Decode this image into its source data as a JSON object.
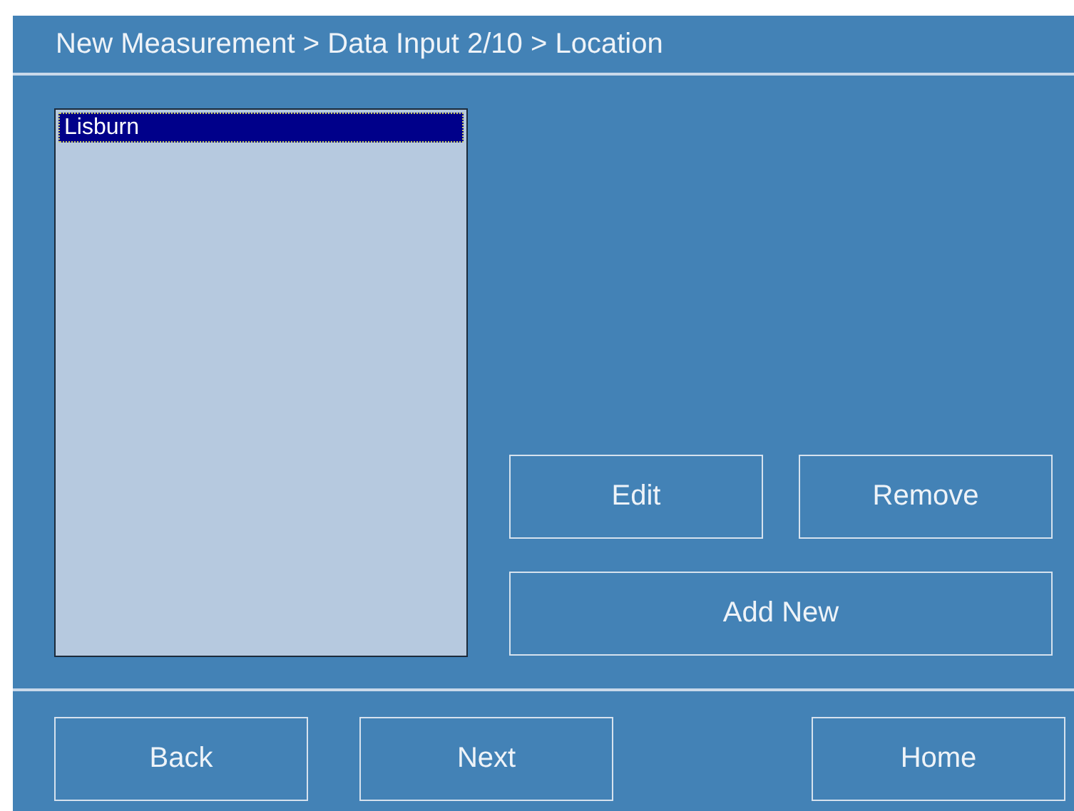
{
  "header": {
    "breadcrumb": "New Measurement > Data Input 2/10 > Location"
  },
  "location_list": {
    "items": [
      {
        "label": "Lisburn",
        "selected": true
      }
    ]
  },
  "actions": [
    {
      "label": "Edit",
      "kind": "half"
    },
    {
      "label": "Remove",
      "kind": "half"
    },
    {
      "label": "Add New",
      "kind": "wide"
    }
  ],
  "footer_buttons": [
    {
      "label": "Back",
      "kind": "left"
    },
    {
      "label": "Next",
      "kind": "left"
    },
    {
      "label": "Home",
      "kind": "right"
    }
  ]
}
